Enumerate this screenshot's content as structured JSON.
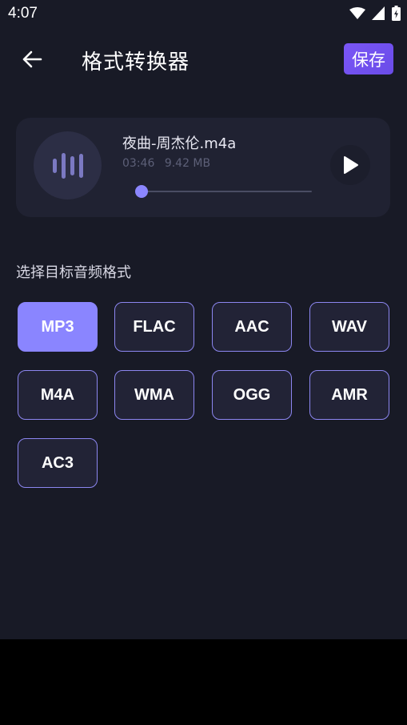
{
  "status_bar": {
    "time": "4:07"
  },
  "header": {
    "title": "格式转换器",
    "save_label": "保存"
  },
  "audio": {
    "file_name": "夜曲-周杰伦.m4a",
    "duration": "03:46",
    "size": "9.42 MB",
    "progress": 0
  },
  "format_section": {
    "label": "选择目标音频格式",
    "selected": "MP3",
    "formats": [
      "MP3",
      "FLAC",
      "AAC",
      "WAV",
      "M4A",
      "WMA",
      "OGG",
      "AMR",
      "AC3"
    ]
  },
  "colors": {
    "background": "#181a26",
    "card": "#202232",
    "accent": "#8a85ff",
    "save_button": "#7a56f6"
  }
}
